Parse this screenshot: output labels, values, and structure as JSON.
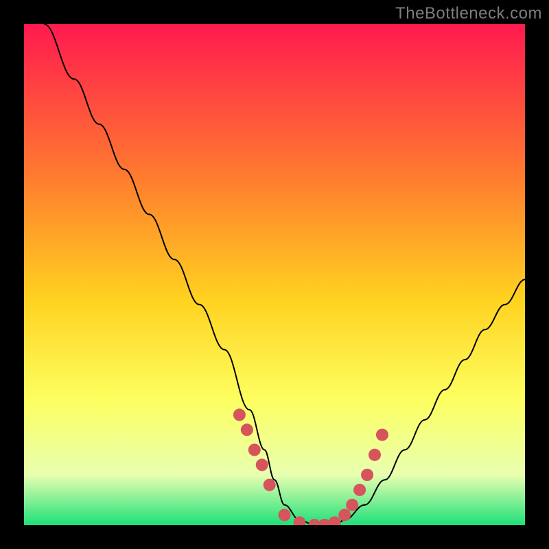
{
  "watermark": "TheBottleneck.com",
  "colors": {
    "gradient_top": "#ff1a4f",
    "gradient_mid1": "#ff7a2f",
    "gradient_mid2": "#ffd220",
    "gradient_low": "#fdff60",
    "gradient_pale": "#e8ffb0",
    "gradient_bottom": "#1fe07a",
    "curve": "#000000",
    "dots": "#d6545b"
  },
  "chart_data": {
    "type": "line",
    "title": "",
    "xlabel": "",
    "ylabel": "",
    "xlim": [
      0,
      100
    ],
    "ylim": [
      0,
      100
    ],
    "series": [
      {
        "name": "bottleneck-curve",
        "x": [
          4,
          10,
          15,
          20,
          25,
          30,
          35,
          40,
          45,
          48,
          50,
          52,
          55,
          58,
          60,
          62,
          64,
          68,
          72,
          76,
          80,
          84,
          88,
          92,
          96,
          100
        ],
        "y": [
          100,
          89,
          80,
          71,
          62,
          53,
          44,
          35,
          23,
          15,
          9,
          4,
          1,
          0,
          0,
          0,
          1,
          4,
          9,
          15,
          21,
          27,
          33,
          39,
          44,
          49
        ]
      }
    ],
    "markers": {
      "name": "highlighted-points",
      "x": [
        43,
        44.5,
        46,
        47.5,
        49,
        52,
        55,
        58,
        60,
        62,
        64,
        65.5,
        67,
        68.5,
        70,
        71.5
      ],
      "y": [
        22,
        19,
        15,
        12,
        8,
        2,
        0.5,
        0,
        0,
        0.5,
        2,
        4,
        7,
        10,
        14,
        18
      ]
    }
  }
}
